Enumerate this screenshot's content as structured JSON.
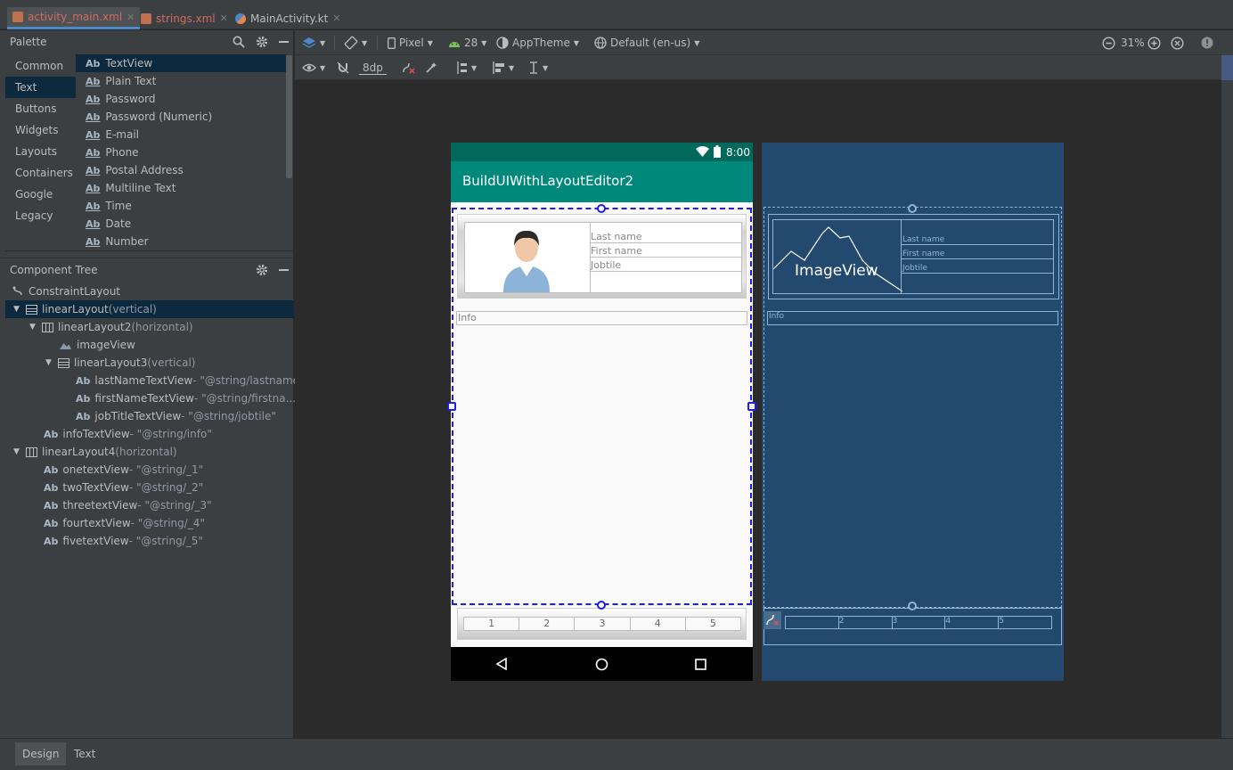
{
  "tabs": [
    {
      "label": "activity_main.xml",
      "active": true,
      "icon": "xml-file-icon"
    },
    {
      "label": "strings.xml",
      "active": false,
      "icon": "xml-file-icon"
    },
    {
      "label": "MainActivity.kt",
      "active": false,
      "icon": "kotlin-file-icon"
    }
  ],
  "palette": {
    "title": "Palette",
    "categories": [
      "Common",
      "Text",
      "Buttons",
      "Widgets",
      "Layouts",
      "Containers",
      "Google",
      "Legacy"
    ],
    "selected_category": "Text",
    "items": [
      "TextView",
      "Plain Text",
      "Password",
      "Password (Numeric)",
      "E-mail",
      "Phone",
      "Postal Address",
      "Multiline Text",
      "Time",
      "Date",
      "Number"
    ],
    "item_prefix": "Ab"
  },
  "component_tree": {
    "title": "Component Tree",
    "rows": [
      {
        "name": "ConstraintLayout",
        "detail": "",
        "icon": "constraint-layout-icon"
      },
      {
        "name": "linearLayout",
        "detail": "(vertical)",
        "icon": "linear-vertical-icon"
      },
      {
        "name": "linearLayout2",
        "detail": "(horizontal)",
        "icon": "linear-horizontal-icon"
      },
      {
        "name": "imageView",
        "detail": "",
        "icon": "image-icon"
      },
      {
        "name": "linearLayout3",
        "detail": "(vertical)",
        "icon": "linear-vertical-icon"
      },
      {
        "name": "lastNameTextView",
        "detail": "- \"@string/lastname\"",
        "icon": "textview-icon"
      },
      {
        "name": "firstNameTextView",
        "detail": "- \"@string/firstna...",
        "icon": "textview-icon"
      },
      {
        "name": "jobTitleTextView",
        "detail": "- \"@string/jobtile\"",
        "icon": "textview-icon"
      },
      {
        "name": "infoTextView",
        "detail": "- \"@string/info\"",
        "icon": "textview-icon"
      },
      {
        "name": "linearLayout4",
        "detail": "(horizontal)",
        "icon": "linear-horizontal-icon"
      },
      {
        "name": "onetextView",
        "detail": "- \"@string/_1\"",
        "icon": "textview-icon"
      },
      {
        "name": "twoTextView",
        "detail": "- \"@string/_2\"",
        "icon": "textview-icon"
      },
      {
        "name": "threetextView",
        "detail": "- \"@string/_3\"",
        "icon": "textview-icon"
      },
      {
        "name": "fourtextView",
        "detail": "- \"@string/_4\"",
        "icon": "textview-icon"
      },
      {
        "name": "fivetextView",
        "detail": "- \"@string/_5\"",
        "icon": "textview-icon"
      }
    ],
    "ab_label": "Ab"
  },
  "toolbar": {
    "device": "Pixel",
    "api": "28",
    "theme": "AppTheme",
    "locale": "Default (en-us)",
    "zoom": "31%",
    "margin": "8dp"
  },
  "device_preview": {
    "time": "8:00",
    "app_title": "BuildUIWithLayoutEditor2",
    "lastname": "Last name",
    "firstname": "First name",
    "jobtitle": "Jobtile",
    "info": "Info",
    "numbers": [
      "1",
      "2",
      "3",
      "4",
      "5"
    ]
  },
  "blueprint": {
    "image_label": "ImageView",
    "lastname": "Last name",
    "firstname": "First name",
    "jobtitle": "Jobtile",
    "info": "Info",
    "numbers": [
      "2",
      "3",
      "4",
      "5"
    ]
  },
  "bottom_tabs": {
    "design": "Design",
    "text": "Text",
    "active": "Design"
  },
  "colors": {
    "accent": "#4a88c7",
    "appbar": "#00897b",
    "statusbar": "#00695c",
    "blueprint": "#234a6e",
    "selection": "#1a1aff"
  }
}
